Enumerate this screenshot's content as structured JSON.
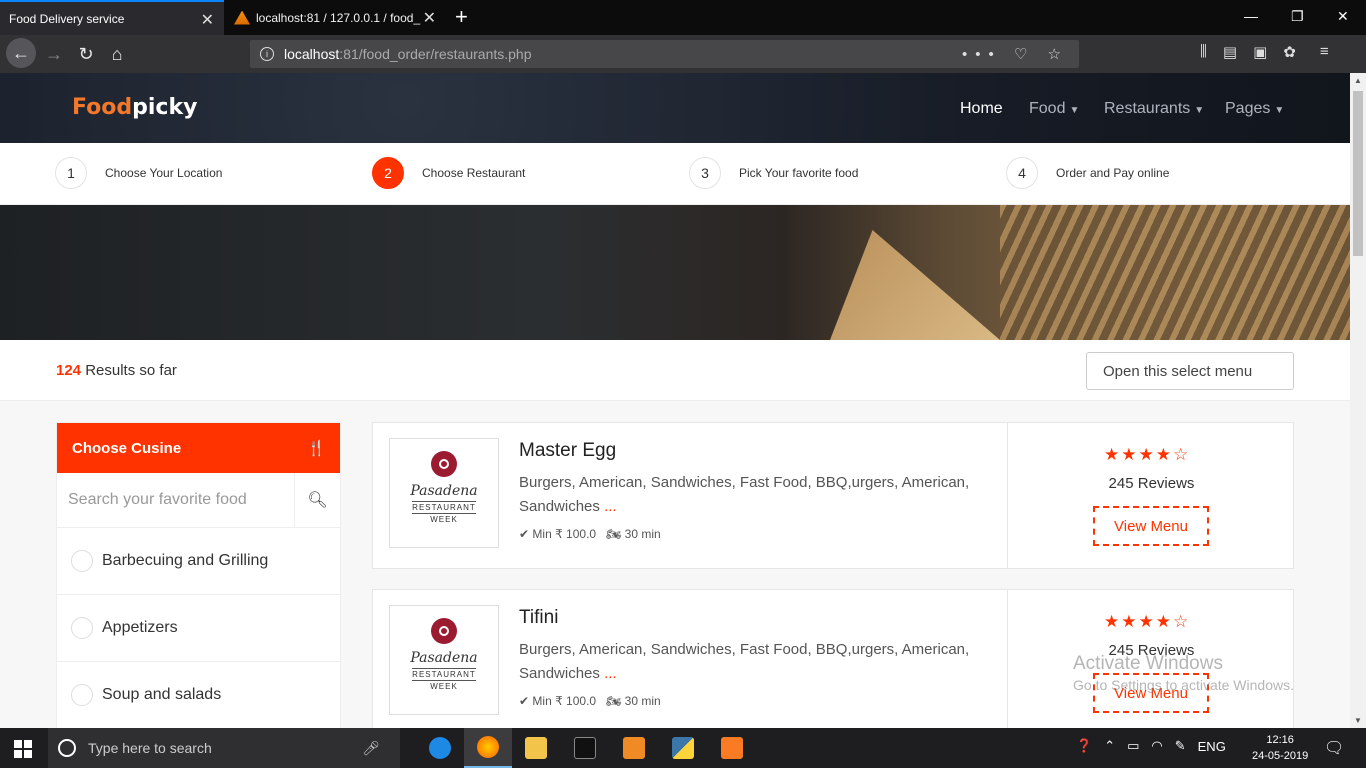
{
  "browser": {
    "tabs": [
      {
        "title": "Food Delivery service",
        "active": true
      },
      {
        "title": "localhost:81 / 127.0.0.1 / food_",
        "active": false
      }
    ],
    "url_prefix": "localhost",
    "url_rest": ":81/food_order/restaurants.php"
  },
  "site": {
    "logo_part1": "Food",
    "logo_part2": "picky",
    "menu": [
      {
        "label": "Home",
        "active": true,
        "dropdown": false
      },
      {
        "label": "Food",
        "active": false,
        "dropdown": true
      },
      {
        "label": "Restaurants",
        "active": false,
        "dropdown": true
      },
      {
        "label": "Pages",
        "active": false,
        "dropdown": true
      }
    ]
  },
  "steps": [
    {
      "num": "1",
      "label": "Choose Your Location",
      "active": false
    },
    {
      "num": "2",
      "label": "Choose Restaurant",
      "active": true
    },
    {
      "num": "3",
      "label": "Pick Your favorite food",
      "active": false
    },
    {
      "num": "4",
      "label": "Order and Pay online",
      "active": false
    }
  ],
  "results": {
    "count": "124",
    "suffix": "Results so far",
    "select_label": "Open this select menu"
  },
  "sidebar": {
    "title": "Choose Cusine",
    "search_placeholder": "Search your favorite food",
    "categories": [
      "Barbecuing and Grilling",
      "Appetizers",
      "Soup and salads"
    ]
  },
  "restaurants": [
    {
      "name": "Master Egg",
      "desc": "Burgers, American, Sandwiches, Fast Food, BBQ,urgers, American, Sandwiches",
      "more": "...",
      "min": "Min ₹ 100.0",
      "time": "30 min",
      "rating": 4,
      "reviews": "245 Reviews",
      "button": "View Menu",
      "logo_script": "Pasadena",
      "logo_line1": "RESTAURANT",
      "logo_line2": "WEEK"
    },
    {
      "name": "Tifini",
      "desc": "Burgers, American, Sandwiches, Fast Food, BBQ,urgers, American, Sandwiches",
      "more": "...",
      "min": "Min ₹ 100.0",
      "time": "30 min",
      "rating": 4,
      "reviews": "245 Reviews",
      "button": "View Menu",
      "logo_script": "Pasadena",
      "logo_line1": "RESTAURANT",
      "logo_line2": "WEEK"
    }
  ],
  "watermark": {
    "line1": "Activate Windows",
    "line2": "Go to Settings to activate Windows."
  },
  "taskbar": {
    "search_placeholder": "Type here to search",
    "lang": "ENG",
    "time": "12:16",
    "date": "24-05-2019"
  },
  "colors": {
    "accent": "#ff3300",
    "logo_orange": "#f3782a"
  }
}
